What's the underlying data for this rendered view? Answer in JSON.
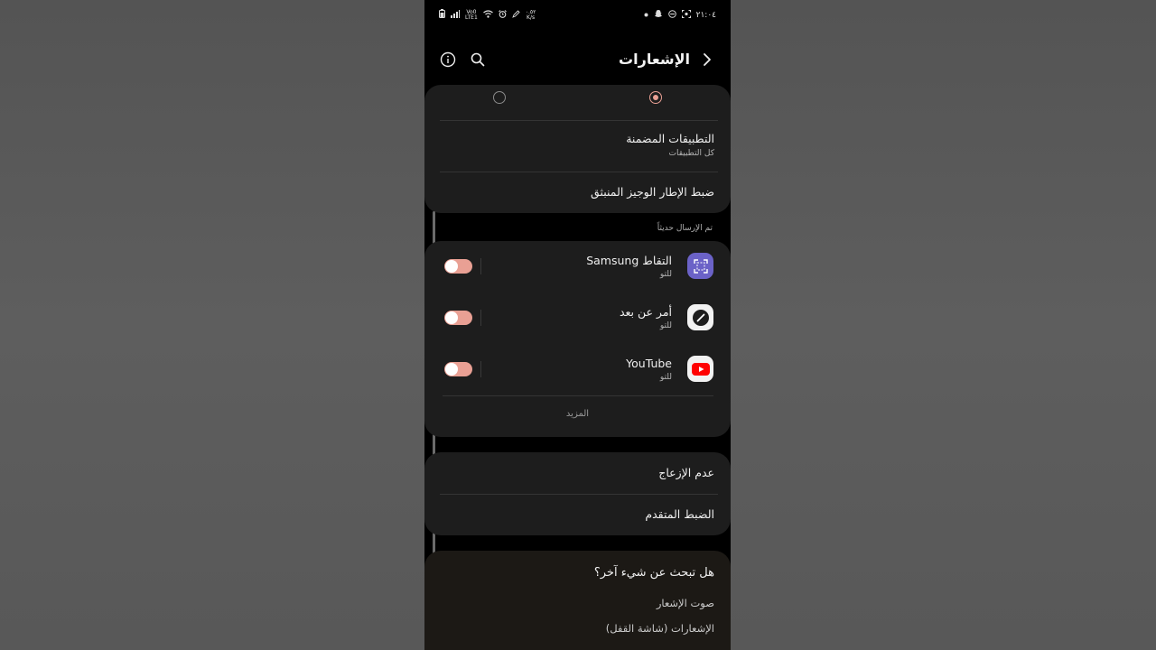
{
  "status_bar": {
    "time": "٢١:٠٤",
    "net_speed_value": "٠.٥٢",
    "net_speed_unit": "K/s",
    "volte_top": "Vo0",
    "volte_bottom": "LTE1"
  },
  "header": {
    "title": "الإشعارات"
  },
  "apps_card": {
    "included_apps_title": "التطبيقات المضمنة",
    "included_apps_subtitle": "كل التطبيقات",
    "brief_popup_title": "ضبط الإطار الوجيز المنبثق"
  },
  "recent": {
    "section_label": "تم الإرسال حديثاً",
    "items": [
      {
        "name": "التقاط Samsung",
        "time": "للتو",
        "enabled": true,
        "icon": "screen-capture-icon",
        "icon_color": "#6b62c7"
      },
      {
        "name": "أمر عن بعد",
        "time": "للتو",
        "enabled": true,
        "icon": "remote-command-icon",
        "icon_color": "#f2f2f2"
      },
      {
        "name": "YouTube",
        "time": "للتو",
        "enabled": true,
        "icon": "youtube-icon",
        "icon_color": "#ff0000"
      }
    ],
    "more_label": "المزيد"
  },
  "settings_card": {
    "do_not_disturb": "عدم الإزعاج",
    "advanced_settings": "الضبط المتقدم"
  },
  "search_card": {
    "title": "هل تبحث عن شيء آخر؟",
    "links": [
      "صوت الإشعار",
      "الإشعارات (شاشة القفل)"
    ]
  },
  "colors": {
    "accent": "#e9a094",
    "background": "#000000",
    "card": "#1d1d1d"
  }
}
